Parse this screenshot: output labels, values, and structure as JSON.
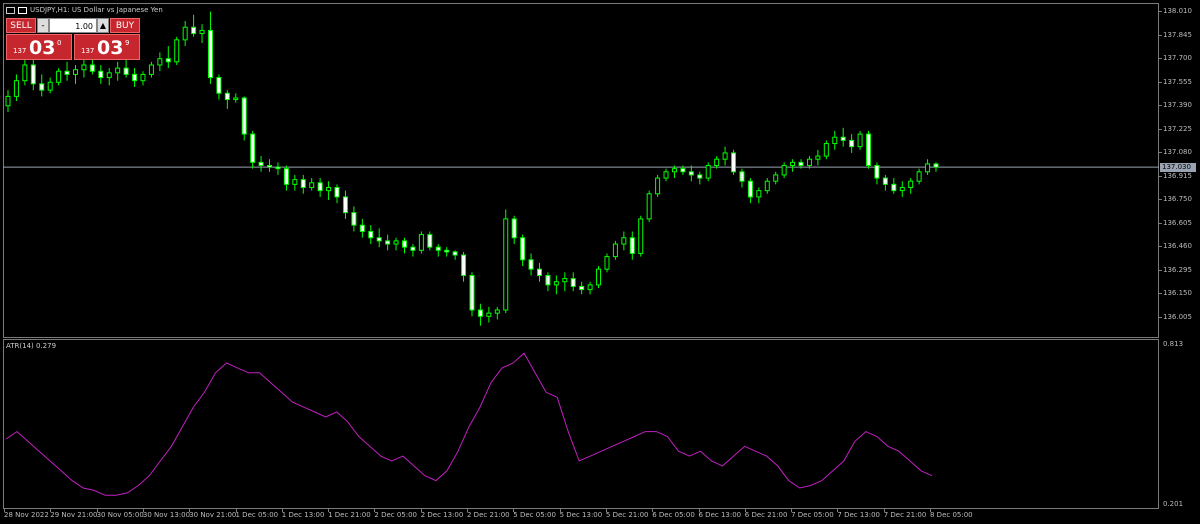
{
  "window": {
    "symbol_title": "USDJPY,H1: US Dollar vs Japanese Yen"
  },
  "one_click": {
    "sell_label": "SELL",
    "buy_label": "BUY",
    "minus_label": "-",
    "plus_label": "▲",
    "lot_value": "1.00",
    "sell_quote_prefix": "137",
    "sell_quote_big": "03",
    "sell_quote_sup": "0",
    "buy_quote_prefix": "137",
    "buy_quote_big": "03",
    "buy_quote_sup": "9"
  },
  "indicator": {
    "title": "ATR(14) 0.279"
  },
  "current_price_label": "137.030",
  "colors": {
    "background": "#000000",
    "candle": "#00ff00",
    "candle_bear_fill": "#000000",
    "candle_bull_fill": "#ffffff",
    "atr_line": "#c020c0",
    "grid_frame": "#7a7a7a",
    "bid_line": "#9aa3b2"
  },
  "price_scale": [
    "138.010",
    "137.845",
    "137.700",
    "137.555",
    "137.390",
    "137.225",
    "137.080",
    "136.915",
    "136.750",
    "136.605",
    "136.460",
    "136.295",
    "136.150",
    "136.005"
  ],
  "atr_scale": [
    "0.813",
    "0.201"
  ],
  "time_axis": [
    "28 Nov 2022",
    "29 Nov 21:00",
    "30 Nov 05:00",
    "30 Nov 13:00",
    "30 Nov 21:00",
    "1 Dec 05:00",
    "1 Dec 13:00",
    "1 Dec 21:00",
    "2 Dec 05:00",
    "2 Dec 13:00",
    "2 Dec 21:00",
    "5 Dec 05:00",
    "5 Dec 13:00",
    "5 Dec 21:00",
    "6 Dec 05:00",
    "6 Dec 13:00",
    "6 Dec 21:00",
    "7 Dec 05:00",
    "7 Dec 13:00",
    "7 Dec 21:00",
    "8 Dec 05:00"
  ],
  "chart_data": {
    "type": "candlestick",
    "symbol": "USDJPY",
    "timeframe": "H1",
    "ylim": [
      135.98,
      138.03
    ],
    "candles": [
      {
        "o": 137.42,
        "h": 137.52,
        "l": 137.38,
        "c": 137.48
      },
      {
        "o": 137.48,
        "h": 137.62,
        "l": 137.45,
        "c": 137.58
      },
      {
        "o": 137.58,
        "h": 137.72,
        "l": 137.55,
        "c": 137.68
      },
      {
        "o": 137.68,
        "h": 137.76,
        "l": 137.52,
        "c": 137.56
      },
      {
        "o": 137.56,
        "h": 137.62,
        "l": 137.48,
        "c": 137.52
      },
      {
        "o": 137.52,
        "h": 137.6,
        "l": 137.5,
        "c": 137.57
      },
      {
        "o": 137.57,
        "h": 137.66,
        "l": 137.55,
        "c": 137.64
      },
      {
        "o": 137.64,
        "h": 137.7,
        "l": 137.58,
        "c": 137.62
      },
      {
        "o": 137.62,
        "h": 137.68,
        "l": 137.56,
        "c": 137.65
      },
      {
        "o": 137.65,
        "h": 137.72,
        "l": 137.6,
        "c": 137.68
      },
      {
        "o": 137.68,
        "h": 137.74,
        "l": 137.62,
        "c": 137.64
      },
      {
        "o": 137.64,
        "h": 137.68,
        "l": 137.56,
        "c": 137.6
      },
      {
        "o": 137.6,
        "h": 137.66,
        "l": 137.55,
        "c": 137.63
      },
      {
        "o": 137.63,
        "h": 137.7,
        "l": 137.58,
        "c": 137.66
      },
      {
        "o": 137.66,
        "h": 137.72,
        "l": 137.6,
        "c": 137.62
      },
      {
        "o": 137.62,
        "h": 137.66,
        "l": 137.54,
        "c": 137.58
      },
      {
        "o": 137.58,
        "h": 137.64,
        "l": 137.55,
        "c": 137.62
      },
      {
        "o": 137.62,
        "h": 137.7,
        "l": 137.6,
        "c": 137.68
      },
      {
        "o": 137.68,
        "h": 137.76,
        "l": 137.64,
        "c": 137.72
      },
      {
        "o": 137.72,
        "h": 137.8,
        "l": 137.66,
        "c": 137.7
      },
      {
        "o": 137.7,
        "h": 137.86,
        "l": 137.68,
        "c": 137.84
      },
      {
        "o": 137.84,
        "h": 137.96,
        "l": 137.8,
        "c": 137.92
      },
      {
        "o": 137.92,
        "h": 138.0,
        "l": 137.86,
        "c": 137.88
      },
      {
        "o": 137.88,
        "h": 137.94,
        "l": 137.82,
        "c": 137.9
      },
      {
        "o": 137.9,
        "h": 138.02,
        "l": 137.56,
        "c": 137.6
      },
      {
        "o": 137.6,
        "h": 137.62,
        "l": 137.46,
        "c": 137.5
      },
      {
        "o": 137.5,
        "h": 137.52,
        "l": 137.4,
        "c": 137.46
      },
      {
        "o": 137.46,
        "h": 137.5,
        "l": 137.44,
        "c": 137.47
      },
      {
        "o": 137.47,
        "h": 137.48,
        "l": 137.2,
        "c": 137.24
      },
      {
        "o": 137.24,
        "h": 137.26,
        "l": 137.02,
        "c": 137.06
      },
      {
        "o": 137.06,
        "h": 137.1,
        "l": 137.0,
        "c": 137.04
      },
      {
        "o": 137.04,
        "h": 137.08,
        "l": 137.0,
        "c": 137.03
      },
      {
        "o": 137.03,
        "h": 137.06,
        "l": 136.98,
        "c": 137.02
      },
      {
        "o": 137.02,
        "h": 137.04,
        "l": 136.88,
        "c": 136.92
      },
      {
        "o": 136.92,
        "h": 136.98,
        "l": 136.88,
        "c": 136.95
      },
      {
        "o": 136.95,
        "h": 136.98,
        "l": 136.86,
        "c": 136.9
      },
      {
        "o": 136.9,
        "h": 136.96,
        "l": 136.88,
        "c": 136.93
      },
      {
        "o": 136.93,
        "h": 136.96,
        "l": 136.84,
        "c": 136.88
      },
      {
        "o": 136.88,
        "h": 136.94,
        "l": 136.82,
        "c": 136.9
      },
      {
        "o": 136.9,
        "h": 136.92,
        "l": 136.8,
        "c": 136.84
      },
      {
        "o": 136.84,
        "h": 136.88,
        "l": 136.7,
        "c": 136.74
      },
      {
        "o": 136.74,
        "h": 136.78,
        "l": 136.62,
        "c": 136.66
      },
      {
        "o": 136.66,
        "h": 136.7,
        "l": 136.58,
        "c": 136.62
      },
      {
        "o": 136.62,
        "h": 136.66,
        "l": 136.54,
        "c": 136.58
      },
      {
        "o": 136.58,
        "h": 136.64,
        "l": 136.52,
        "c": 136.56
      },
      {
        "o": 136.56,
        "h": 136.6,
        "l": 136.5,
        "c": 136.54
      },
      {
        "o": 136.54,
        "h": 136.58,
        "l": 136.5,
        "c": 136.56
      },
      {
        "o": 136.56,
        "h": 136.58,
        "l": 136.48,
        "c": 136.52
      },
      {
        "o": 136.52,
        "h": 136.54,
        "l": 136.46,
        "c": 136.5
      },
      {
        "o": 136.5,
        "h": 136.62,
        "l": 136.48,
        "c": 136.6
      },
      {
        "o": 136.6,
        "h": 136.62,
        "l": 136.5,
        "c": 136.52
      },
      {
        "o": 136.52,
        "h": 136.54,
        "l": 136.46,
        "c": 136.5
      },
      {
        "o": 136.5,
        "h": 136.52,
        "l": 136.46,
        "c": 136.49
      },
      {
        "o": 136.49,
        "h": 136.5,
        "l": 136.44,
        "c": 136.47
      },
      {
        "o": 136.47,
        "h": 136.49,
        "l": 136.3,
        "c": 136.34
      },
      {
        "o": 136.34,
        "h": 136.36,
        "l": 136.08,
        "c": 136.12
      },
      {
        "o": 136.12,
        "h": 136.16,
        "l": 136.02,
        "c": 136.08
      },
      {
        "o": 136.08,
        "h": 136.14,
        "l": 136.04,
        "c": 136.1
      },
      {
        "o": 136.1,
        "h": 136.14,
        "l": 136.06,
        "c": 136.12
      },
      {
        "o": 136.12,
        "h": 136.76,
        "l": 136.1,
        "c": 136.7
      },
      {
        "o": 136.7,
        "h": 136.72,
        "l": 136.54,
        "c": 136.58
      },
      {
        "o": 136.58,
        "h": 136.6,
        "l": 136.4,
        "c": 136.44
      },
      {
        "o": 136.44,
        "h": 136.48,
        "l": 136.34,
        "c": 136.38
      },
      {
        "o": 136.38,
        "h": 136.42,
        "l": 136.3,
        "c": 136.34
      },
      {
        "o": 136.34,
        "h": 136.36,
        "l": 136.24,
        "c": 136.28
      },
      {
        "o": 136.28,
        "h": 136.34,
        "l": 136.22,
        "c": 136.3
      },
      {
        "o": 136.3,
        "h": 136.36,
        "l": 136.24,
        "c": 136.32
      },
      {
        "o": 136.32,
        "h": 136.36,
        "l": 136.24,
        "c": 136.27
      },
      {
        "o": 136.27,
        "h": 136.3,
        "l": 136.22,
        "c": 136.25
      },
      {
        "o": 136.25,
        "h": 136.3,
        "l": 136.22,
        "c": 136.28
      },
      {
        "o": 136.28,
        "h": 136.4,
        "l": 136.26,
        "c": 136.38
      },
      {
        "o": 136.38,
        "h": 136.48,
        "l": 136.36,
        "c": 136.46
      },
      {
        "o": 136.46,
        "h": 136.56,
        "l": 136.44,
        "c": 136.54
      },
      {
        "o": 136.54,
        "h": 136.62,
        "l": 136.5,
        "c": 136.58
      },
      {
        "o": 136.58,
        "h": 136.62,
        "l": 136.44,
        "c": 136.48
      },
      {
        "o": 136.48,
        "h": 136.72,
        "l": 136.46,
        "c": 136.7
      },
      {
        "o": 136.7,
        "h": 136.88,
        "l": 136.68,
        "c": 136.86
      },
      {
        "o": 136.86,
        "h": 136.98,
        "l": 136.84,
        "c": 136.96
      },
      {
        "o": 136.96,
        "h": 137.02,
        "l": 136.94,
        "c": 137.0
      },
      {
        "o": 137.0,
        "h": 137.04,
        "l": 136.96,
        "c": 137.02
      },
      {
        "o": 137.02,
        "h": 137.04,
        "l": 136.98,
        "c": 137.0
      },
      {
        "o": 137.0,
        "h": 137.04,
        "l": 136.94,
        "c": 136.98
      },
      {
        "o": 136.98,
        "h": 137.0,
        "l": 136.92,
        "c": 136.96
      },
      {
        "o": 136.96,
        "h": 137.06,
        "l": 136.94,
        "c": 137.04
      },
      {
        "o": 137.04,
        "h": 137.1,
        "l": 137.02,
        "c": 137.08
      },
      {
        "o": 137.08,
        "h": 137.16,
        "l": 137.04,
        "c": 137.12
      },
      {
        "o": 137.12,
        "h": 137.14,
        "l": 136.98,
        "c": 137.0
      },
      {
        "o": 137.0,
        "h": 137.02,
        "l": 136.9,
        "c": 136.94
      },
      {
        "o": 136.94,
        "h": 136.96,
        "l": 136.8,
        "c": 136.84
      },
      {
        "o": 136.84,
        "h": 136.9,
        "l": 136.8,
        "c": 136.88
      },
      {
        "o": 136.88,
        "h": 136.96,
        "l": 136.86,
        "c": 136.94
      },
      {
        "o": 136.94,
        "h": 137.0,
        "l": 136.92,
        "c": 136.98
      },
      {
        "o": 136.98,
        "h": 137.06,
        "l": 136.96,
        "c": 137.04
      },
      {
        "o": 137.04,
        "h": 137.08,
        "l": 137.0,
        "c": 137.06
      },
      {
        "o": 137.06,
        "h": 137.08,
        "l": 137.02,
        "c": 137.04
      },
      {
        "o": 137.04,
        "h": 137.1,
        "l": 137.02,
        "c": 137.08
      },
      {
        "o": 137.08,
        "h": 137.14,
        "l": 137.04,
        "c": 137.1
      },
      {
        "o": 137.1,
        "h": 137.2,
        "l": 137.08,
        "c": 137.18
      },
      {
        "o": 137.18,
        "h": 137.26,
        "l": 137.14,
        "c": 137.22
      },
      {
        "o": 137.22,
        "h": 137.28,
        "l": 137.16,
        "c": 137.2
      },
      {
        "o": 137.2,
        "h": 137.24,
        "l": 137.12,
        "c": 137.16
      },
      {
        "o": 137.16,
        "h": 137.26,
        "l": 137.14,
        "c": 137.24
      },
      {
        "o": 137.24,
        "h": 137.26,
        "l": 137.02,
        "c": 137.04
      },
      {
        "o": 137.04,
        "h": 137.06,
        "l": 136.92,
        "c": 136.96
      },
      {
        "o": 136.96,
        "h": 136.98,
        "l": 136.88,
        "c": 136.92
      },
      {
        "o": 136.92,
        "h": 136.96,
        "l": 136.86,
        "c": 136.88
      },
      {
        "o": 136.88,
        "h": 136.94,
        "l": 136.84,
        "c": 136.9
      },
      {
        "o": 136.9,
        "h": 136.96,
        "l": 136.86,
        "c": 136.94
      },
      {
        "o": 136.94,
        "h": 137.02,
        "l": 136.92,
        "c": 137.0
      },
      {
        "o": 137.0,
        "h": 137.08,
        "l": 136.98,
        "c": 137.05
      },
      {
        "o": 137.05,
        "h": 137.06,
        "l": 137.0,
        "c": 137.03
      }
    ],
    "atr": [
      0.45,
      0.48,
      0.44,
      0.4,
      0.36,
      0.32,
      0.28,
      0.25,
      0.24,
      0.22,
      0.22,
      0.23,
      0.26,
      0.3,
      0.36,
      0.42,
      0.5,
      0.58,
      0.64,
      0.72,
      0.76,
      0.74,
      0.72,
      0.72,
      0.68,
      0.64,
      0.6,
      0.58,
      0.56,
      0.54,
      0.56,
      0.52,
      0.46,
      0.42,
      0.38,
      0.36,
      0.38,
      0.34,
      0.3,
      0.28,
      0.32,
      0.4,
      0.5,
      0.58,
      0.68,
      0.74,
      0.76,
      0.8,
      0.72,
      0.64,
      0.62,
      0.48,
      0.36,
      0.38,
      0.4,
      0.42,
      0.44,
      0.46,
      0.48,
      0.48,
      0.46,
      0.4,
      0.38,
      0.4,
      0.36,
      0.34,
      0.38,
      0.42,
      0.4,
      0.38,
      0.34,
      0.28,
      0.25,
      0.26,
      0.28,
      0.32,
      0.36,
      0.44,
      0.48,
      0.46,
      0.42,
      0.4,
      0.36,
      0.32,
      0.3
    ]
  }
}
